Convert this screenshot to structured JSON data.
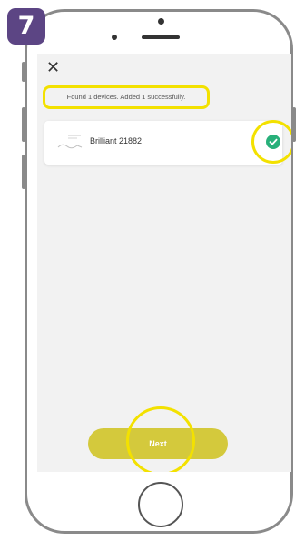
{
  "step": {
    "number": "7"
  },
  "header": {
    "close_symbol": "✕"
  },
  "status": {
    "message": "Found 1 devices. Added 1 successfully."
  },
  "devices": [
    {
      "name": "Brilliant 21882",
      "status": "success"
    }
  ],
  "actions": {
    "next_label": "Next"
  },
  "colors": {
    "accent": "#d4c93c",
    "highlight": "#f3e100",
    "success": "#28b07a",
    "badge": "#5c4584"
  }
}
